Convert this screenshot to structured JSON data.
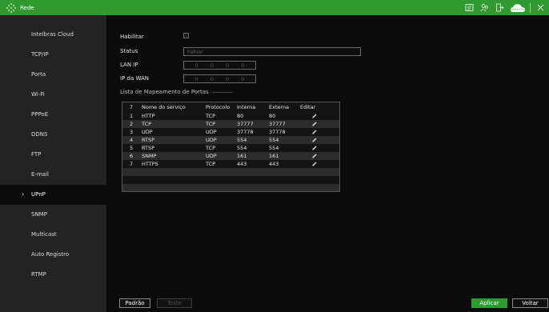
{
  "topbar": {
    "title": "Rede",
    "cloud_label": "Intelbras Cloud",
    "icons": [
      "notes-icon",
      "users-icon",
      "logout-icon",
      "cloud-icon",
      "close-icon"
    ]
  },
  "sidebar": {
    "items": [
      {
        "label": "Intelbras Cloud"
      },
      {
        "label": "TCP/IP"
      },
      {
        "label": "Porta"
      },
      {
        "label": "Wi-Fi"
      },
      {
        "label": "PPPoE"
      },
      {
        "label": "DDNS"
      },
      {
        "label": "FTP"
      },
      {
        "label": "E-mail"
      },
      {
        "label": "UPnP",
        "active": true
      },
      {
        "label": "SNMP"
      },
      {
        "label": "Multicast"
      },
      {
        "label": "Auto Registro"
      },
      {
        "label": "RTMP"
      }
    ]
  },
  "form": {
    "enable_label": "Habilitar",
    "enabled": false,
    "status_label": "Status",
    "status_value": "Falhar",
    "lan_ip_label": "LAN IP",
    "lan_ip": [
      "0",
      "0",
      "0",
      "0"
    ],
    "wan_ip_label": "IP da WAN",
    "wan_ip": [
      "0",
      "0",
      "0",
      "0"
    ]
  },
  "port_mapping": {
    "section_title": "Lista de Mapeamento de Portas",
    "header": {
      "count": "7",
      "service": "Nome do serviço",
      "protocol": "Protocolo",
      "internal": "Interna",
      "external": "Externa",
      "edit": "Editar"
    },
    "rows": [
      {
        "n": "1",
        "service": "HTTP",
        "protocol": "TCP",
        "internal": "80",
        "external": "80"
      },
      {
        "n": "2",
        "service": "TCP",
        "protocol": "TCP",
        "internal": "37777",
        "external": "37777"
      },
      {
        "n": "3",
        "service": "UDP",
        "protocol": "UDP",
        "internal": "37778",
        "external": "37778"
      },
      {
        "n": "4",
        "service": "RTSP",
        "protocol": "UDP",
        "internal": "554",
        "external": "554"
      },
      {
        "n": "5",
        "service": "RTSP",
        "protocol": "TCP",
        "internal": "554",
        "external": "554"
      },
      {
        "n": "6",
        "service": "SNMP",
        "protocol": "UDP",
        "internal": "161",
        "external": "161"
      },
      {
        "n": "7",
        "service": "HTTPS",
        "protocol": "TCP",
        "internal": "443",
        "external": "443"
      }
    ]
  },
  "buttons": {
    "default": "Padrão",
    "test": "Teste",
    "apply": "Aplicar",
    "back": "Voltar"
  },
  "colors": {
    "accent": "#2f9a2f",
    "sidebar_bg": "#232323",
    "content_bg": "#0b0b0b"
  }
}
